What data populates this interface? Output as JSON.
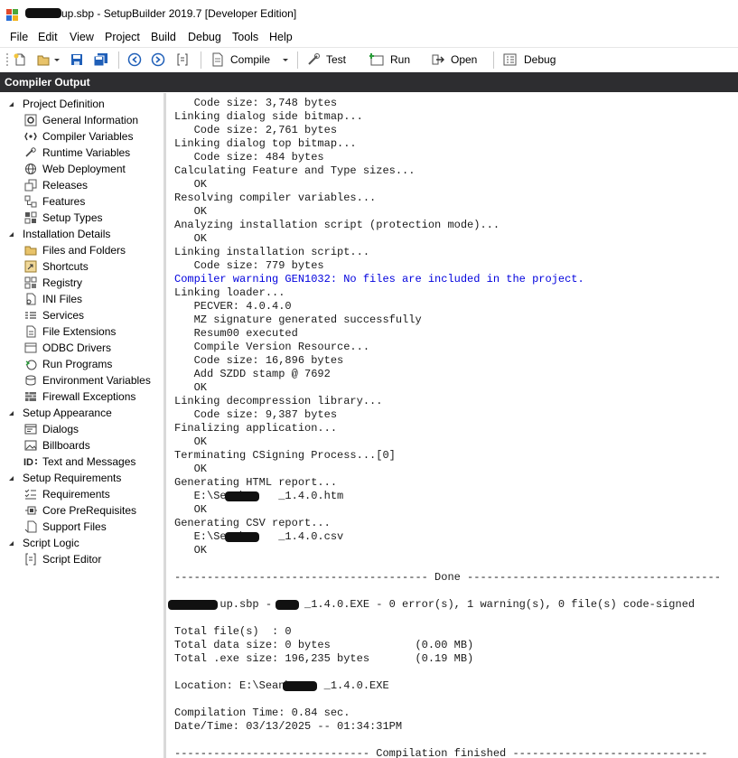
{
  "window": {
    "title_visible": "up.sbp - SetupBuilder 2019.7 [Developer Edition]"
  },
  "menu": [
    "File",
    "Edit",
    "View",
    "Project",
    "Build",
    "Debug",
    "Tools",
    "Help"
  ],
  "toolbar": {
    "compile_label": "Compile",
    "test_label": "Test",
    "run_label": "Run",
    "open_label": "Open",
    "debug_label": "Debug"
  },
  "panel": {
    "title": "Compiler Output"
  },
  "tree": [
    {
      "label": "Project Definition",
      "icon": "expand-triangle",
      "level": 0
    },
    {
      "label": "General Information",
      "icon": "gear-icon",
      "level": 1
    },
    {
      "label": "Compiler Variables",
      "icon": "variables-icon",
      "level": 1
    },
    {
      "label": "Runtime Variables",
      "icon": "runtime-icon",
      "level": 1
    },
    {
      "label": "Web Deployment",
      "icon": "globe-icon",
      "level": 1
    },
    {
      "label": "Releases",
      "icon": "releases-icon",
      "level": 1
    },
    {
      "label": "Features",
      "icon": "features-icon",
      "level": 1
    },
    {
      "label": "Setup Types",
      "icon": "setup-types-icon",
      "level": 1
    },
    {
      "label": "Installation Details",
      "icon": "expand-triangle",
      "level": 0
    },
    {
      "label": "Files and Folders",
      "icon": "folder-icon",
      "level": 1
    },
    {
      "label": "Shortcuts",
      "icon": "shortcut-icon",
      "level": 1
    },
    {
      "label": "Registry",
      "icon": "registry-icon",
      "level": 1
    },
    {
      "label": "INI Files",
      "icon": "ini-icon",
      "level": 1
    },
    {
      "label": "Services",
      "icon": "services-icon",
      "level": 1
    },
    {
      "label": "File Extensions",
      "icon": "file-ext-icon",
      "level": 1
    },
    {
      "label": "ODBC Drivers",
      "icon": "odbc-icon",
      "level": 1
    },
    {
      "label": "Run Programs",
      "icon": "run-icon",
      "level": 1
    },
    {
      "label": "Environment Variables",
      "icon": "env-icon",
      "level": 1
    },
    {
      "label": "Firewall Exceptions",
      "icon": "firewall-icon",
      "level": 1
    },
    {
      "label": "Setup Appearance",
      "icon": "expand-triangle",
      "level": 0
    },
    {
      "label": "Dialogs",
      "icon": "dialog-icon",
      "level": 1
    },
    {
      "label": "Billboards",
      "icon": "billboard-icon",
      "level": 1
    },
    {
      "label": "Text and Messages",
      "icon": "text-id-icon",
      "level": 1
    },
    {
      "label": "Setup Requirements",
      "icon": "expand-triangle",
      "level": 0
    },
    {
      "label": "Requirements",
      "icon": "requirements-icon",
      "level": 1
    },
    {
      "label": "Core PreRequisites",
      "icon": "prereq-icon",
      "level": 1
    },
    {
      "label": "Support Files",
      "icon": "support-icon",
      "level": 1
    },
    {
      "label": "Script Logic",
      "icon": "expand-triangle",
      "level": 0
    },
    {
      "label": "Script Editor",
      "icon": "script-icon",
      "level": 1
    }
  ],
  "output": [
    "   Code size: 3,748 bytes",
    "Linking dialog side bitmap...",
    "   Code size: 2,761 bytes",
    "Linking dialog top bitmap...",
    "   Code size: 484 bytes",
    "Calculating Feature and Type sizes...",
    "   OK",
    "Resolving compiler variables...",
    "   OK",
    "Analyzing installation script (protection mode)...",
    "   OK",
    "Linking installation script...",
    "   Code size: 779 bytes",
    "Compiler warning GEN1032: No files are included in the project.",
    "Linking loader...",
    "   PECVER: 4.0.4.0",
    "   MZ signature generated successfully",
    "   Resum00 executed",
    "   Compile Version Resource...",
    "   Code size: 16,896 bytes",
    "   Add SZDD stamp @ 7692",
    "   OK",
    "Linking decompression library...",
    "   Code size: 9,387 bytes",
    "Finalizing application...",
    "   OK",
    "Terminating CSigning Process...[0]",
    "   OK",
    "Generating HTML report...",
    "   E:\\Sean\\     _1.4.0.htm",
    "   OK",
    "Generating CSV report...",
    "   E:\\Sean\\     _1.4.0.csv",
    "   OK",
    "",
    "--------------------------------------- Done ---------------------------------------",
    "",
    "       up.sbp -     _1.4.0.EXE - 0 error(s), 1 warning(s), 0 file(s) code-signed",
    "",
    "Total file(s)  : 0",
    "Total data size: 0 bytes             (0.00 MB)",
    "Total .exe size: 196,235 bytes       (0.19 MB)",
    "",
    "Location: E:\\Sean\\     _1.4.0.EXE",
    "",
    "Compilation Time: 0.84 sec.",
    "Date/Time: 03/13/2025 -- 01:34:31PM",
    "",
    "------------------------------ Compilation finished ------------------------------"
  ],
  "colors": {
    "panel_header_bg": "#2d2d30",
    "warning_text": "#0000dd"
  }
}
